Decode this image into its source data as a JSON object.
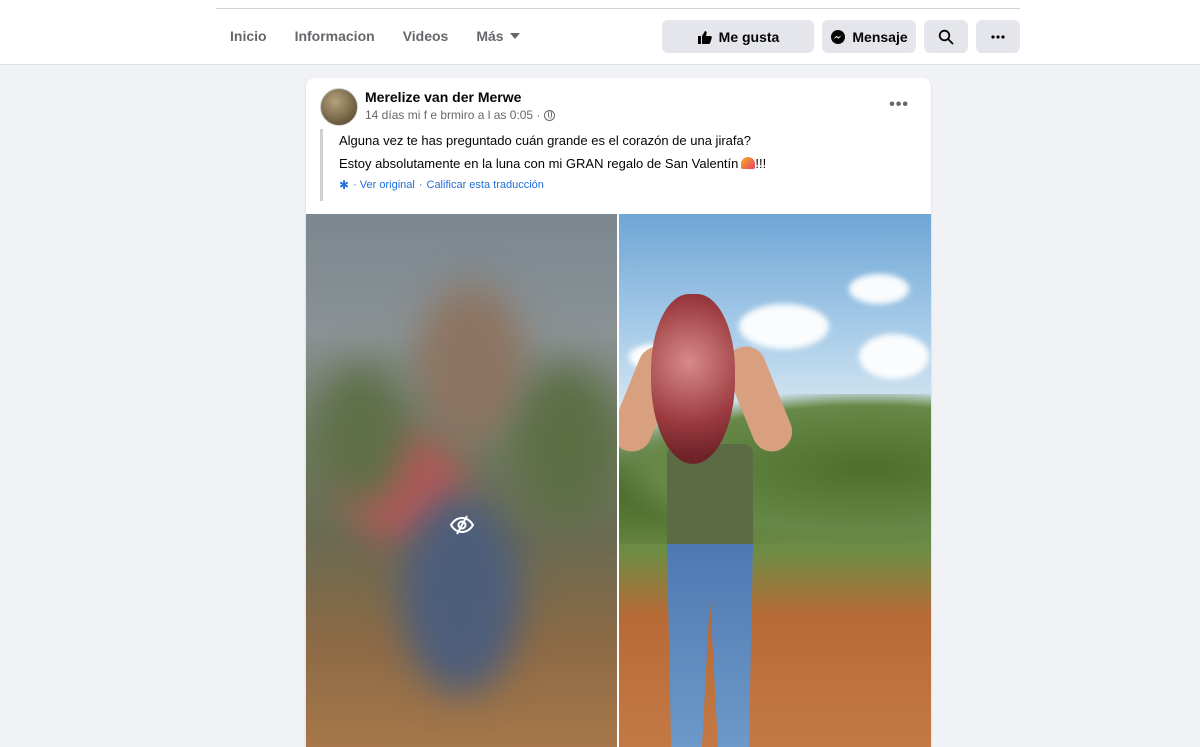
{
  "nav": {
    "items": [
      {
        "label": "Inicio"
      },
      {
        "label": "Informacion"
      },
      {
        "label": "Videos"
      },
      {
        "label": "Más"
      }
    ]
  },
  "actions": {
    "like_label": "Me gusta",
    "message_label": "Mensaje",
    "search_icon": "search-icon",
    "more_icon": "more-dots-icon"
  },
  "post": {
    "author": "Merelize van der Merwe",
    "meta": "14 días mi f e brmiro a l as 0:05 ·",
    "text_line1": "Alguna vez te has preguntado cuán grande es el corazón de una jirafa?",
    "text_line2": "Estoy absolutamente en la luna con mi GRAN regalo de San Valentín",
    "text_line2_suffix": "!!!",
    "translate": {
      "view_original": "· Ver original",
      "separator": "·",
      "rate": "Calificar esta traducción"
    },
    "more_label": "•••"
  },
  "colors": {
    "link": "#216fdb",
    "background": "#f0f2f5",
    "button": "#e4e6eb"
  }
}
